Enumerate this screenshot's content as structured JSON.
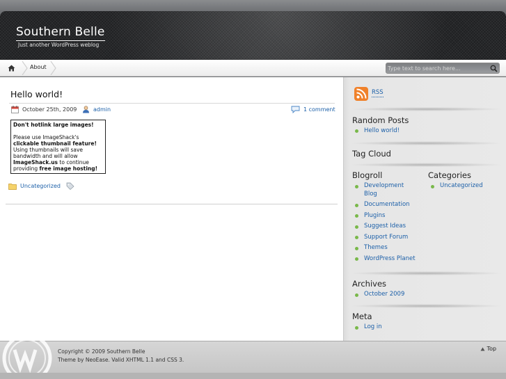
{
  "site": {
    "title": "Southern Belle",
    "description": "Just another WordPress weblog"
  },
  "nav": {
    "home_icon": "home-icon",
    "items": [
      {
        "label": "About"
      }
    ]
  },
  "search": {
    "placeholder": "Type text to search here...",
    "button_icon": "magnifier-icon"
  },
  "post": {
    "title": "Hello world!",
    "date": "October 25th, 2009",
    "author": "admin",
    "comments": "1 comment",
    "image_text": {
      "line1": "Don't hotlink large images!",
      "line2": "Please use ImageShack's",
      "line3": "clickable thumbnail feature!",
      "line4": "Using thumbnails will save",
      "line5": "bandwidth and will allow",
      "line6a": "ImageShack.us",
      "line6b": " to continue",
      "line7a": "providing ",
      "line7b": "free image hosting!"
    },
    "category": "Uncategorized"
  },
  "sidebar": {
    "rss_label": "RSS",
    "random_posts": {
      "title": "Random Posts",
      "items": [
        "Hello world!"
      ]
    },
    "tag_cloud": {
      "title": "Tag Cloud"
    },
    "blogroll": {
      "title": "Blogroll",
      "items": [
        "Development",
        "Blog",
        "Documentation",
        "Plugins",
        "Suggest Ideas",
        "Support Forum",
        "Themes",
        "WordPress Planet"
      ]
    },
    "categories": {
      "title": "Categories",
      "items": [
        "Uncategorized"
      ]
    },
    "archives": {
      "title": "Archives",
      "items": [
        "October 2009"
      ]
    },
    "meta": {
      "title": "Meta",
      "items": [
        "Log in"
      ]
    }
  },
  "footer": {
    "copyright": "Copyright © 2009 Southern Belle",
    "theme_prefix": "Theme by ",
    "theme_author": "NeoEase",
    "valid_prefix": ". Valid ",
    "xhtml": "XHTML 1.1",
    "and": " and ",
    "css": "CSS 3",
    "end": ".",
    "top_label": "Top"
  },
  "colors": {
    "link": "#1b5fa8",
    "bullet": "#79b84a",
    "header": "#1f2022"
  }
}
